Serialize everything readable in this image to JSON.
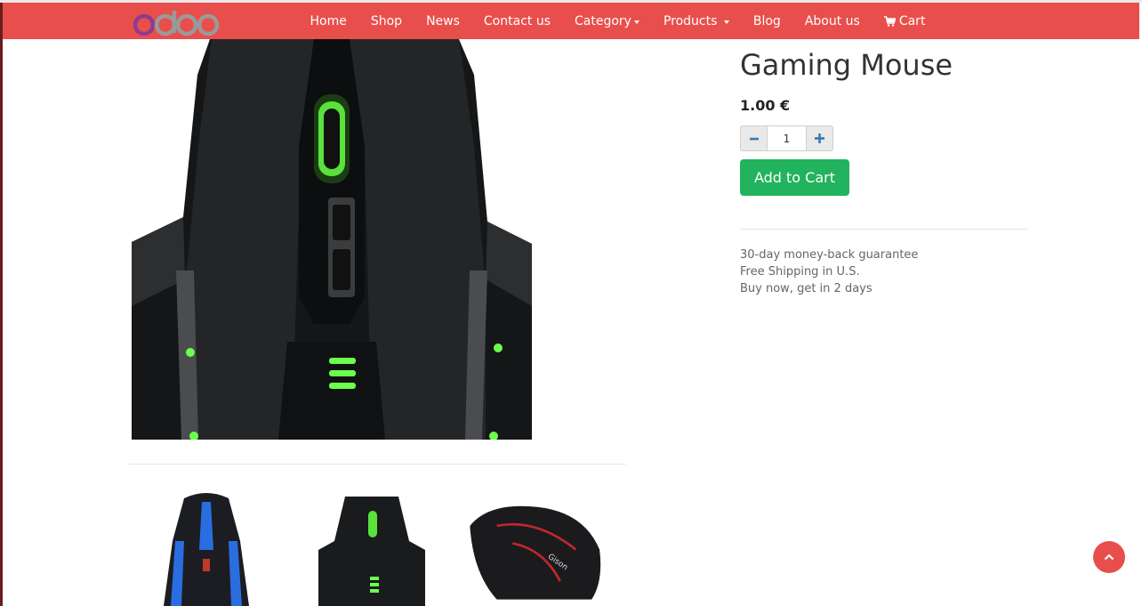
{
  "brand": {
    "logo_text": "odoo"
  },
  "nav": {
    "items": [
      {
        "label": "Home"
      },
      {
        "label": "Shop"
      },
      {
        "label": "News"
      },
      {
        "label": "Contact us"
      },
      {
        "label": "Category"
      },
      {
        "label": "Products "
      },
      {
        "label": "Blog"
      },
      {
        "label": "About us"
      },
      {
        "label": "Cart"
      }
    ]
  },
  "product": {
    "name": "Gaming Mouse",
    "price": "1.00 €",
    "quantity": "1",
    "add_to_cart_label": "Add to Cart",
    "guarantees": [
      "30-day money-back guarantee",
      "Free Shipping in U.S.",
      "Buy now, get in 2 days"
    ]
  },
  "colors": {
    "navbar": "#e84f4c",
    "add_to_cart": "#21b35d",
    "accent_blue": "#337ab7"
  },
  "icons": [
    "cart-icon",
    "minus-icon",
    "plus-icon",
    "chevron-up-icon",
    "caret-down-icon"
  ]
}
